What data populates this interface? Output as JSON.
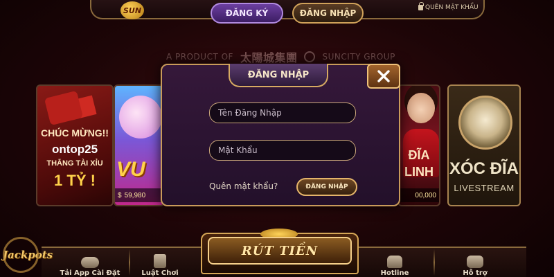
{
  "header": {
    "logo_text": "SUN",
    "register_label": "ĐĂNG KÝ",
    "login_label": "ĐĂNG NHẬP",
    "forgot_label": "QUÊN MẬT KHẨU"
  },
  "product": {
    "prefix": "A PRODUCT OF",
    "brand_cn": "太陽城集團",
    "group": "SUNCITY GROUP"
  },
  "cards": {
    "left": {
      "line1": "CHÚC MỪNG!!",
      "line2": "ontop25",
      "line3": "THẮNG TÀI XỈU",
      "line4": "1 TỶ !"
    },
    "vu": {
      "title": "VU",
      "currency": "$",
      "amount": "59,980"
    },
    "lady": {
      "line1": "ĐĨA",
      "line2": "LINH",
      "amount": "00,000"
    },
    "xoc": {
      "title": "XÓC ĐĨA",
      "subtitle": "LIVESTREAM"
    }
  },
  "modal": {
    "title": "ĐĂNG NHẬP",
    "username_placeholder": "Tên Đăng Nhập",
    "password_placeholder": "Mật Khẩu",
    "forgot_label": "Quên mật khẩu?",
    "submit_label": "ĐĂNG NHẬP"
  },
  "bottom": {
    "jackpots": "Jackpots",
    "withdraw_label": "RÚT TIỀN",
    "nav": [
      {
        "label": "Tải App Cài Đặt",
        "icon": "gamepad-icon"
      },
      {
        "label": "Luật Chơi",
        "icon": "rules-icon"
      },
      {
        "label": "Hotline",
        "icon": "phone-icon"
      },
      {
        "label": "Hỗ trợ",
        "icon": "chat-icon"
      }
    ]
  },
  "colors": {
    "gold_border": "#c99b5a",
    "modal_bg": "#2a1230",
    "register_purple": "#6c3fa0"
  }
}
